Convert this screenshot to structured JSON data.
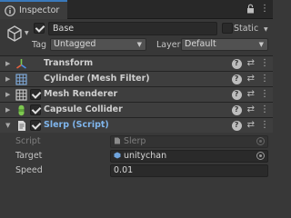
{
  "tab": {
    "title": "Inspector",
    "icon": "info-icon"
  },
  "tab_tools": {
    "lock_icon": "lock-icon",
    "menu_icon": "kebab-menu-icon"
  },
  "object": {
    "icon": "cube-icon",
    "active": true,
    "name": "Base",
    "static_label": "Static",
    "static_checked": false,
    "tag_label": "Tag",
    "tag_value": "Untagged",
    "layer_label": "Layer",
    "layer_value": "Default"
  },
  "components": [
    {
      "name": "Transform",
      "icon": "transform-icon",
      "has_checkbox": false
    },
    {
      "name": "Cylinder (Mesh Filter)",
      "icon": "mesh-filter-icon",
      "has_checkbox": false
    },
    {
      "name": "Mesh Renderer",
      "icon": "mesh-renderer-icon",
      "has_checkbox": true,
      "enabled": true
    },
    {
      "name": "Capsule Collider",
      "icon": "capsule-collider-icon",
      "has_checkbox": true,
      "enabled": true
    },
    {
      "name": "Slerp (Script)",
      "icon": "script-icon",
      "has_checkbox": true,
      "enabled": true,
      "name_color": "#7fb5ec"
    }
  ],
  "script_props": [
    {
      "label": "Script",
      "value": "Slerp",
      "disabled": true,
      "icon": "script-file-icon"
    },
    {
      "label": "Target",
      "value": "unitychan",
      "disabled": false,
      "icon": "gameobject-icon"
    },
    {
      "label": "Speed",
      "value": "0.01",
      "disabled": false
    }
  ],
  "colors": {
    "accent": "#3a79bb",
    "background": "#383838",
    "header": "#3e3e3e"
  }
}
